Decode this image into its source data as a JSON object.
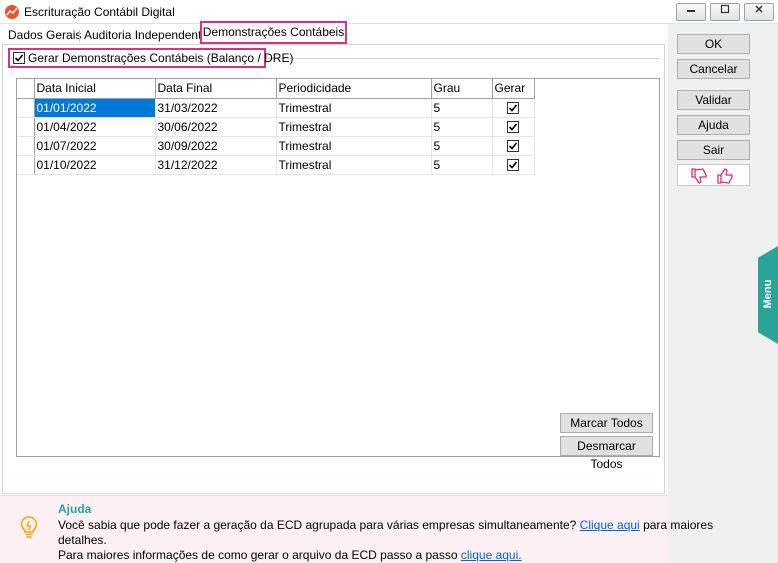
{
  "window": {
    "title": "Escrituração Contábil Digital"
  },
  "tabs": [
    {
      "label": "Dados Gerais",
      "active": false
    },
    {
      "label": "Auditoria Independente",
      "active": false
    },
    {
      "label": "Demonstrações Contábeis",
      "active": true
    }
  ],
  "generate_checkbox": {
    "label": "Gerar Demonstrações Contábeis (Balanço / DRE)",
    "checked": true
  },
  "grid": {
    "columns": [
      "Data Inicial",
      "Data Final",
      "Periodicidade",
      "Grau",
      "Gerar"
    ],
    "rows": [
      {
        "data_inicial": "01/01/2022",
        "data_final": "31/03/2022",
        "periodicidade": "Trimestral",
        "grau": "5",
        "gerar": true
      },
      {
        "data_inicial": "01/04/2022",
        "data_final": "30/06/2022",
        "periodicidade": "Trimestral",
        "grau": "5",
        "gerar": true
      },
      {
        "data_inicial": "01/07/2022",
        "data_final": "30/09/2022",
        "periodicidade": "Trimestral",
        "grau": "5",
        "gerar": true
      },
      {
        "data_inicial": "01/10/2022",
        "data_final": "31/12/2022",
        "periodicidade": "Trimestral",
        "grau": "5",
        "gerar": true
      }
    ]
  },
  "buttons": {
    "ok": "OK",
    "cancel": "Cancelar",
    "validate": "Validar",
    "help": "Ajuda",
    "exit": "Sair",
    "mark_all": "Marcar Todos",
    "unmark_all": "Desmarcar Todos"
  },
  "menu_tab": "Menu",
  "help_panel": {
    "title": "Ajuda",
    "line1": "Você sabia que pode fazer a geração da ECD agrupada para várias empresas simultaneamente?",
    "link1": "Clique aqui",
    "line1_end": "para maiores",
    "line2": "detalhes.",
    "line3": "Para maiores informações de como gerar o arquivo da ECD passo a passo",
    "link2": "clique aqui."
  },
  "icons": {
    "app": "chart-up-icon",
    "minimize": "minimize-icon",
    "maximize": "maximize-icon",
    "close": "close-icon",
    "thumbs_down": "thumbs-down-icon",
    "thumbs_up": "thumbs-up-icon",
    "help": "lightbulb-icon",
    "check": "checkmark-icon"
  },
  "colors": {
    "selection": "#0078d7",
    "highlight_border": "#d63384",
    "accent": "#2aa59a",
    "help_background": "#fdf0f4",
    "link": "#0066cc",
    "thumbs": "#e03060"
  }
}
